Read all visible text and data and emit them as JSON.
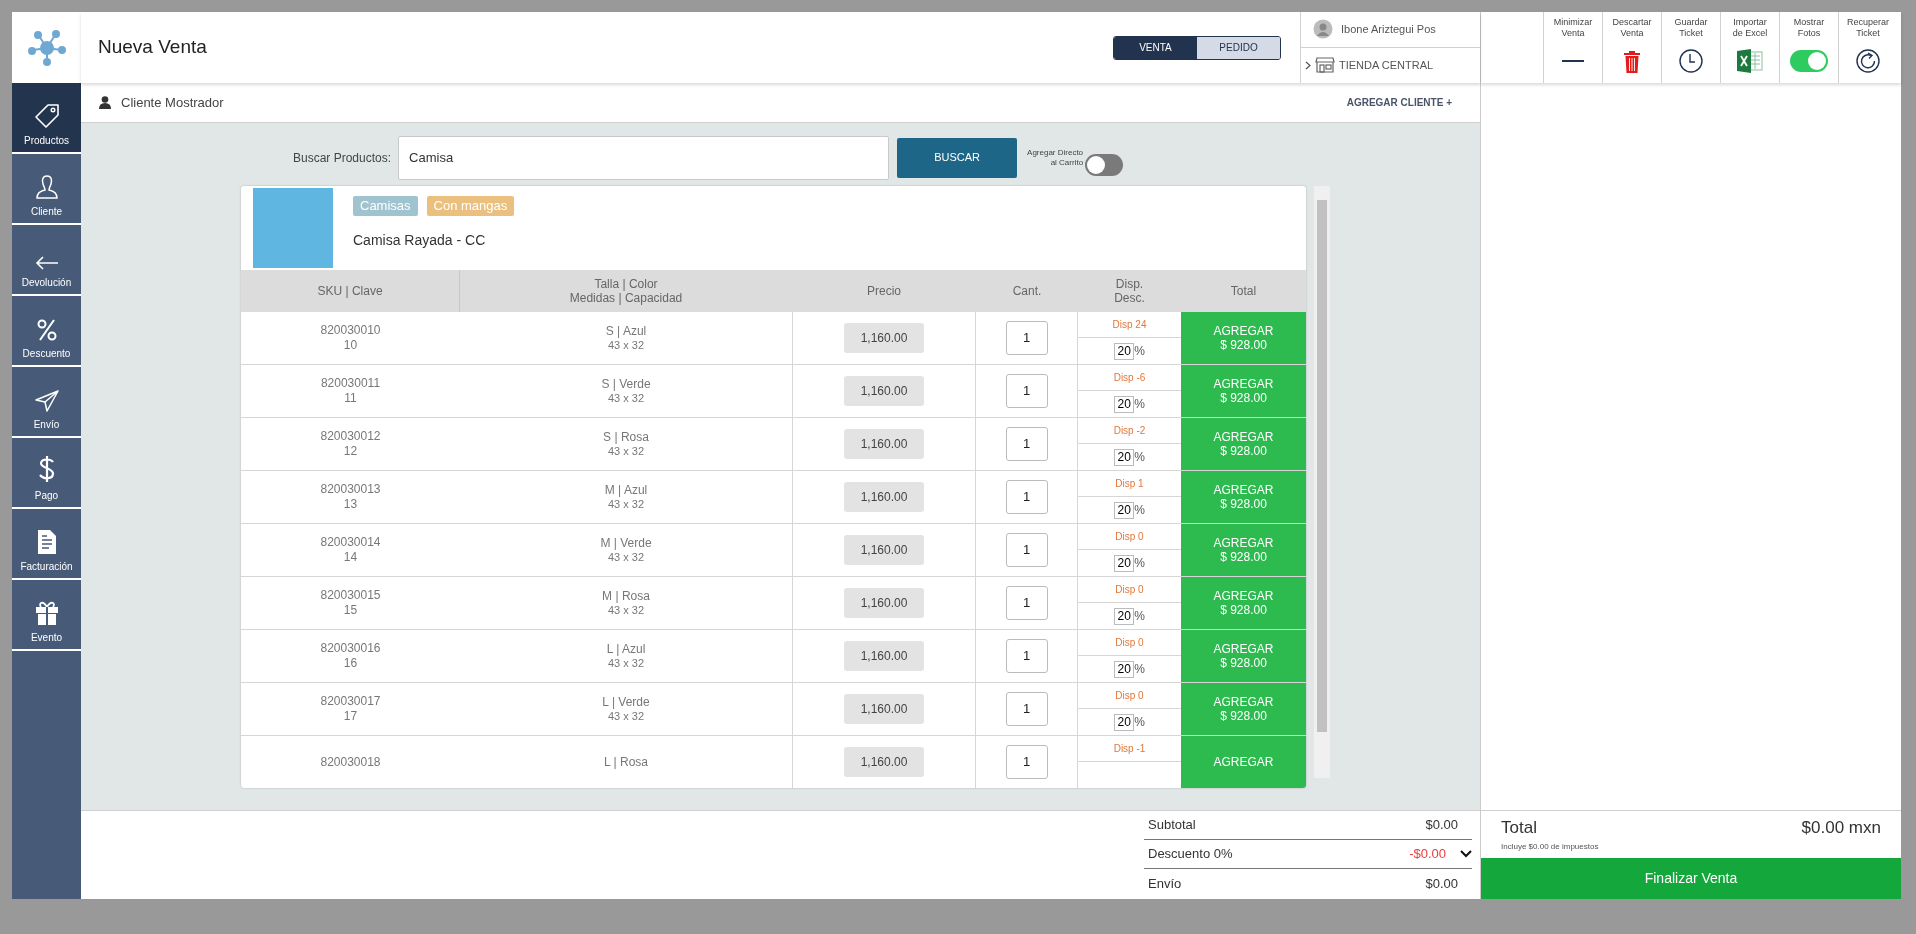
{
  "sidebar": {
    "items": [
      {
        "label": "Productos",
        "selected": true
      },
      {
        "label": "Cliente",
        "selected": false
      },
      {
        "label": "Devolución",
        "selected": false
      },
      {
        "label": "Descuento",
        "selected": false
      },
      {
        "label": "Envío",
        "selected": false
      },
      {
        "label": "Pago",
        "selected": false
      },
      {
        "label": "Facturación",
        "selected": false
      },
      {
        "label": "Evento",
        "selected": false
      }
    ]
  },
  "header": {
    "title": "Nueva Venta",
    "mode_tabs": [
      {
        "label": "VENTA",
        "selected": true
      },
      {
        "label": "PEDIDO",
        "selected": false
      }
    ],
    "user": "Ibone Ariztegui Pos",
    "store": "TIENDA CENTRAL"
  },
  "toolbar": [
    {
      "label": "Minimizar\nVenta",
      "kind": "minimize"
    },
    {
      "label": "Descartar\nVenta",
      "kind": "discard"
    },
    {
      "label": "Guardar\nTicket",
      "kind": "save"
    },
    {
      "label": "Importar\nde Excel",
      "kind": "excel"
    },
    {
      "label": "Mostrar\nFotos",
      "kind": "toggle",
      "on": true
    },
    {
      "label": "Recuperar\nTicket",
      "kind": "recover"
    }
  ],
  "client": {
    "name": "Cliente Mostrador",
    "add_button": "AGREGAR CLIENTE +"
  },
  "search": {
    "label": "Buscar Productos:",
    "value": "Camisa",
    "button": "BUSCAR",
    "direct_add": {
      "label": "Agregar Directo\nal Carrito",
      "on": false
    }
  },
  "product": {
    "tags": [
      {
        "label": "Camisas",
        "color": "#9fc4cf"
      },
      {
        "label": "Con mangas",
        "color": "#ebc07e"
      }
    ],
    "name": "Camisa Rayada - CC",
    "table": {
      "columns": [
        "SKU | Clave",
        "Talla | Color\nMedidas | Capacidad",
        "Precio",
        "Cant.",
        "Disp.\nDesc.",
        "Total"
      ],
      "rows": [
        {
          "sku": "820030010",
          "clave": "10",
          "talla_color": "S | Azul",
          "medidas": "43 x 32",
          "precio": "1,160.00",
          "cantidad": "1",
          "disponible": "Disp 24",
          "descuento": "20",
          "descuento_unit": "%",
          "button": "AGREGAR",
          "total": "$ 928.00"
        },
        {
          "sku": "820030011",
          "clave": "11",
          "talla_color": "S | Verde",
          "medidas": "43 x 32",
          "precio": "1,160.00",
          "cantidad": "1",
          "disponible": "Disp -6",
          "descuento": "20",
          "descuento_unit": "%",
          "button": "AGREGAR",
          "total": "$ 928.00"
        },
        {
          "sku": "820030012",
          "clave": "12",
          "talla_color": "S | Rosa",
          "medidas": "43 x 32",
          "precio": "1,160.00",
          "cantidad": "1",
          "disponible": "Disp -2",
          "descuento": "20",
          "descuento_unit": "%",
          "button": "AGREGAR",
          "total": "$ 928.00"
        },
        {
          "sku": "820030013",
          "clave": "13",
          "talla_color": "M | Azul",
          "medidas": "43 x 32",
          "precio": "1,160.00",
          "cantidad": "1",
          "disponible": "Disp 1",
          "descuento": "20",
          "descuento_unit": "%",
          "button": "AGREGAR",
          "total": "$ 928.00"
        },
        {
          "sku": "820030014",
          "clave": "14",
          "talla_color": "M | Verde",
          "medidas": "43 x 32",
          "precio": "1,160.00",
          "cantidad": "1",
          "disponible": "Disp 0",
          "descuento": "20",
          "descuento_unit": "%",
          "button": "AGREGAR",
          "total": "$ 928.00"
        },
        {
          "sku": "820030015",
          "clave": "15",
          "talla_color": "M | Rosa",
          "medidas": "43 x 32",
          "precio": "1,160.00",
          "cantidad": "1",
          "disponible": "Disp 0",
          "descuento": "20",
          "descuento_unit": "%",
          "button": "AGREGAR",
          "total": "$ 928.00"
        },
        {
          "sku": "820030016",
          "clave": "16",
          "talla_color": "L | Azul",
          "medidas": "43 x 32",
          "precio": "1,160.00",
          "cantidad": "1",
          "disponible": "Disp 0",
          "descuento": "20",
          "descuento_unit": "%",
          "button": "AGREGAR",
          "total": "$ 928.00"
        },
        {
          "sku": "820030017",
          "clave": "17",
          "talla_color": "L | Verde",
          "medidas": "43 x 32",
          "precio": "1,160.00",
          "cantidad": "1",
          "disponible": "Disp 0",
          "descuento": "20",
          "descuento_unit": "%",
          "button": "AGREGAR",
          "total": "$ 928.00"
        },
        {
          "sku": "820030018",
          "talla_color": "L | Rosa",
          "precio": "1,160.00",
          "cantidad": "1",
          "disponible": "Disp -1",
          "button": "AGREGAR"
        }
      ]
    }
  },
  "totals": [
    {
      "label": "Subtotal",
      "value": "$0.00",
      "kind": "plain"
    },
    {
      "label": "Descuento 0%",
      "value": "-$0.00",
      "kind": "discount"
    },
    {
      "label": "Envío",
      "value": "$0.00",
      "kind": "plain"
    }
  ],
  "checkout": {
    "label": "Total",
    "value": "$0.00 mxn",
    "note": "Incluye $0.00 de impuestos",
    "button": "Finalizar Venta"
  }
}
